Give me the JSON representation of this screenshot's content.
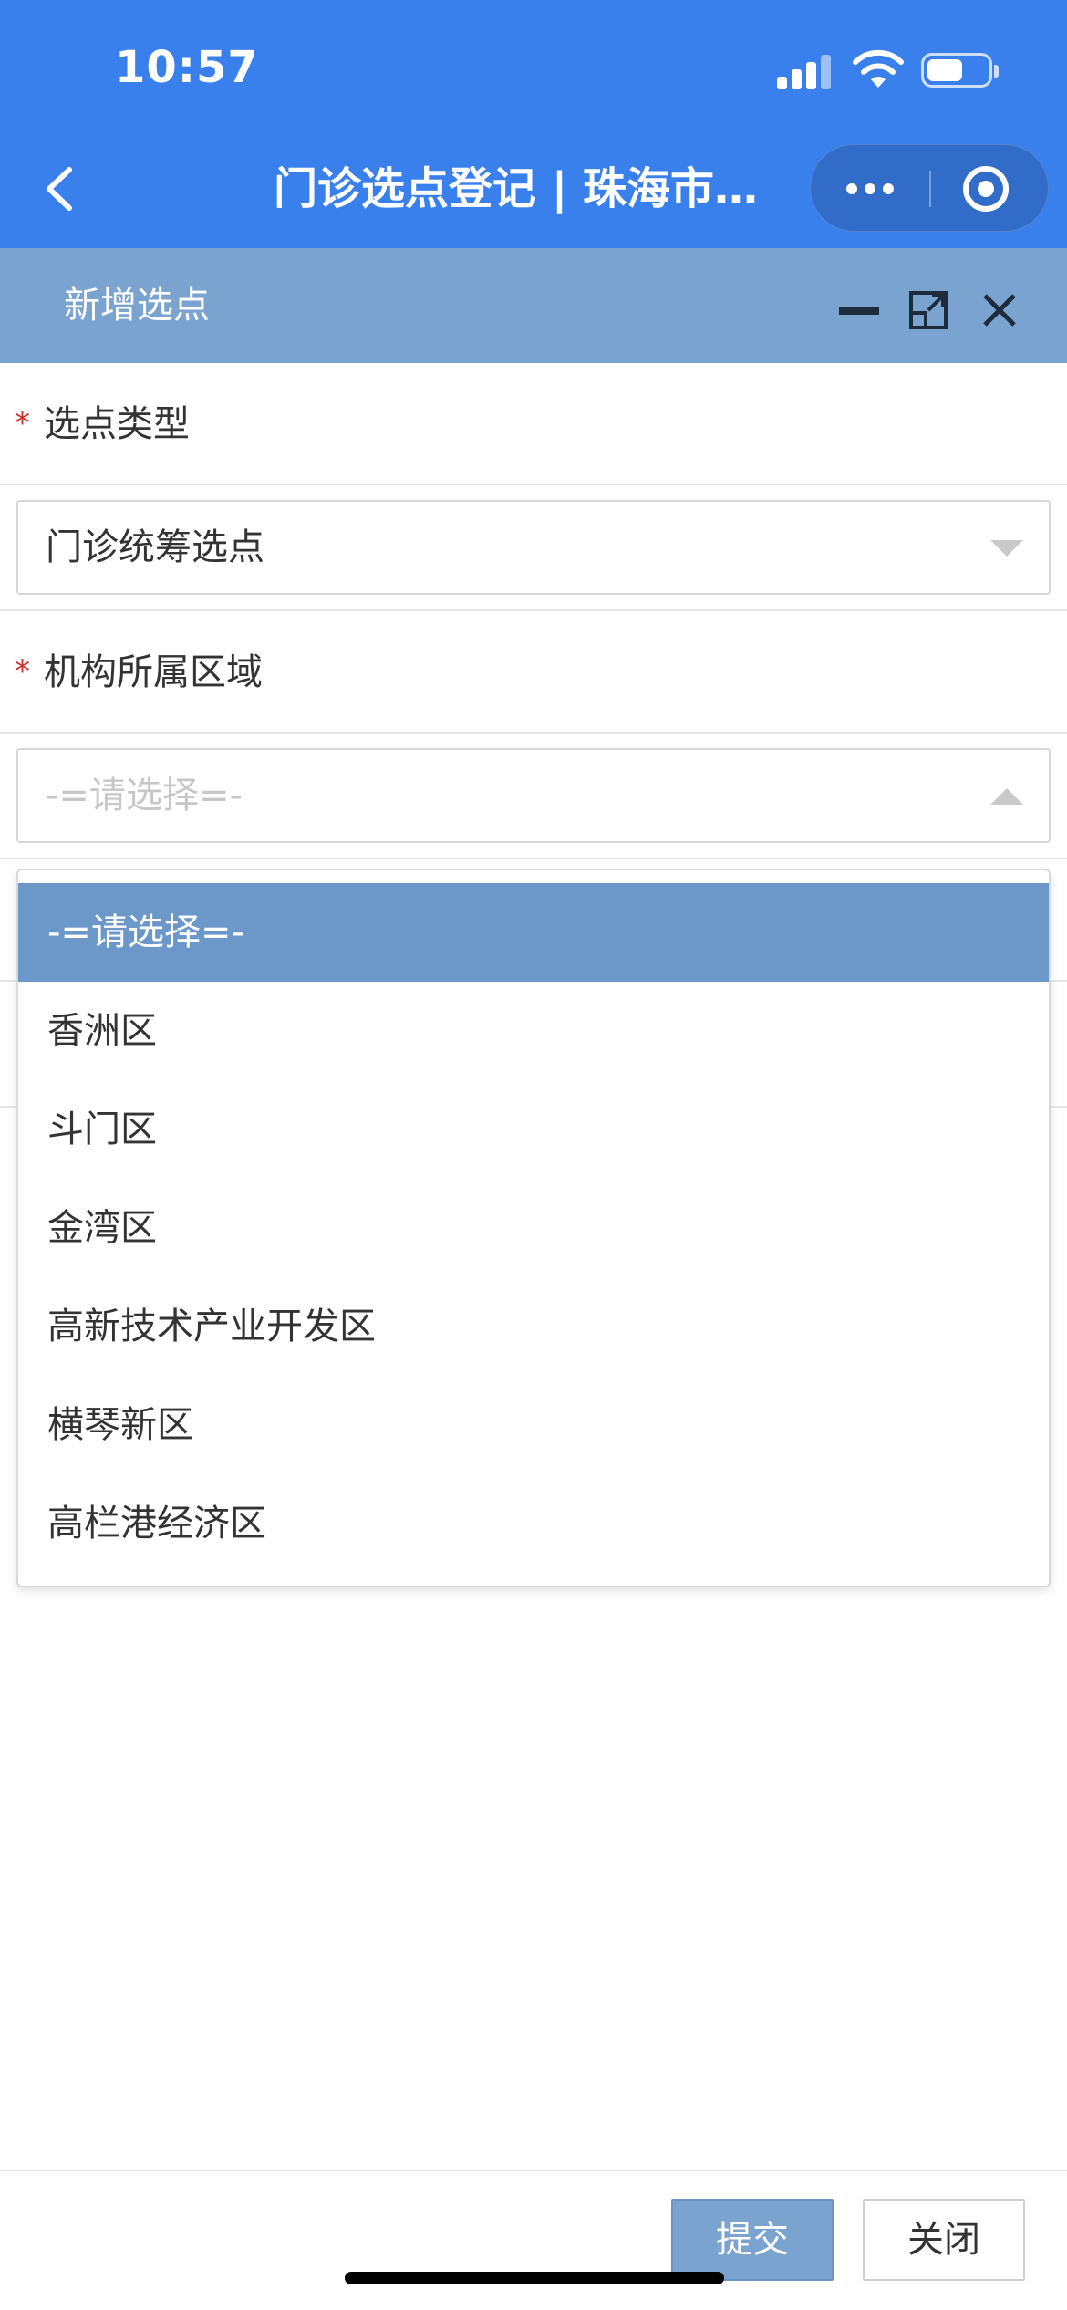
{
  "status_bar": {
    "time": "10:57"
  },
  "nav": {
    "title": "门诊选点登记 | 珠海市…"
  },
  "dialog": {
    "title": "新增选点"
  },
  "form": {
    "field1": {
      "label": "选点类型",
      "required_mark": "*",
      "value": "门诊统筹选点"
    },
    "field2": {
      "label": "机构所属区域",
      "required_mark": "*",
      "placeholder": "-=请选择=-"
    }
  },
  "dropdown": {
    "options": [
      {
        "label": "-=请选择=-"
      },
      {
        "label": "香洲区"
      },
      {
        "label": "斗门区"
      },
      {
        "label": "金湾区"
      },
      {
        "label": "高新技术产业开发区"
      },
      {
        "label": "横琴新区"
      },
      {
        "label": "高栏港经济区"
      }
    ]
  },
  "footer": {
    "submit_label": "提交",
    "close_label": "关闭"
  },
  "colors": {
    "nav_blue": "#3a80ec",
    "dialog_header": "#7aa3d0",
    "active_option": "#6b98c9",
    "required": "#d0312d"
  }
}
